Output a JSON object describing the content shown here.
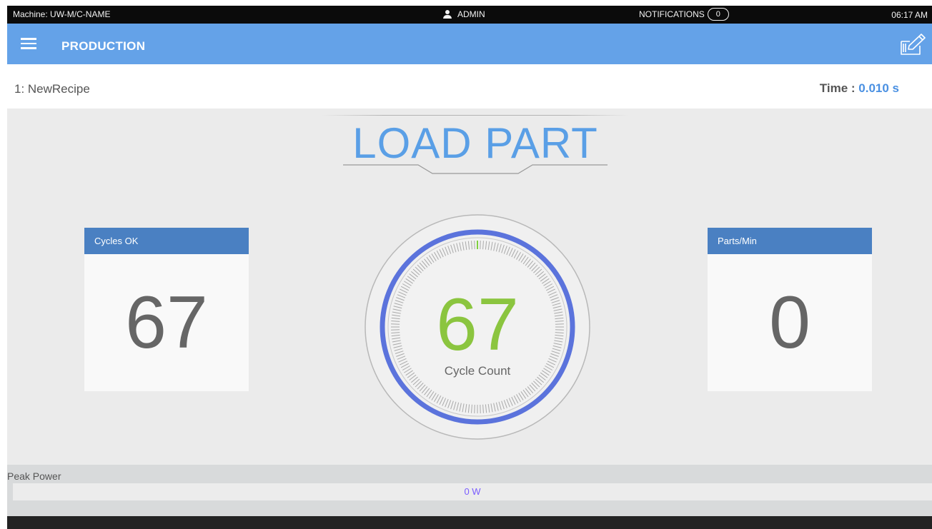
{
  "status": {
    "machine": "Machine: UW-M/C-NAME",
    "user": "ADMIN",
    "notifications_label": "NOTIFICATIONS",
    "notifications_count": "0",
    "time": "06:17 AM"
  },
  "header": {
    "title": "PRODUCTION",
    "menu_icon": "hamburger-menu-icon",
    "edit_icon": "edit-icon",
    "color": "#64a2e8"
  },
  "recipe": {
    "name": "1: NewRecipe",
    "time_label": "Time : ",
    "time_value": "0.010 s"
  },
  "banner": {
    "text": "LOAD PART",
    "color": "#5a9fe6"
  },
  "cards": {
    "cycles_ok": {
      "label": "Cycles OK",
      "value": "67"
    },
    "parts_min": {
      "label": "Parts/Min",
      "value": "0"
    }
  },
  "gauge": {
    "value": "67",
    "label": "Cycle Count",
    "value_color": "#8bc53f",
    "ring_color": "#5b73dc"
  },
  "peak_power": {
    "label": "Peak Power",
    "value": "0 W"
  }
}
